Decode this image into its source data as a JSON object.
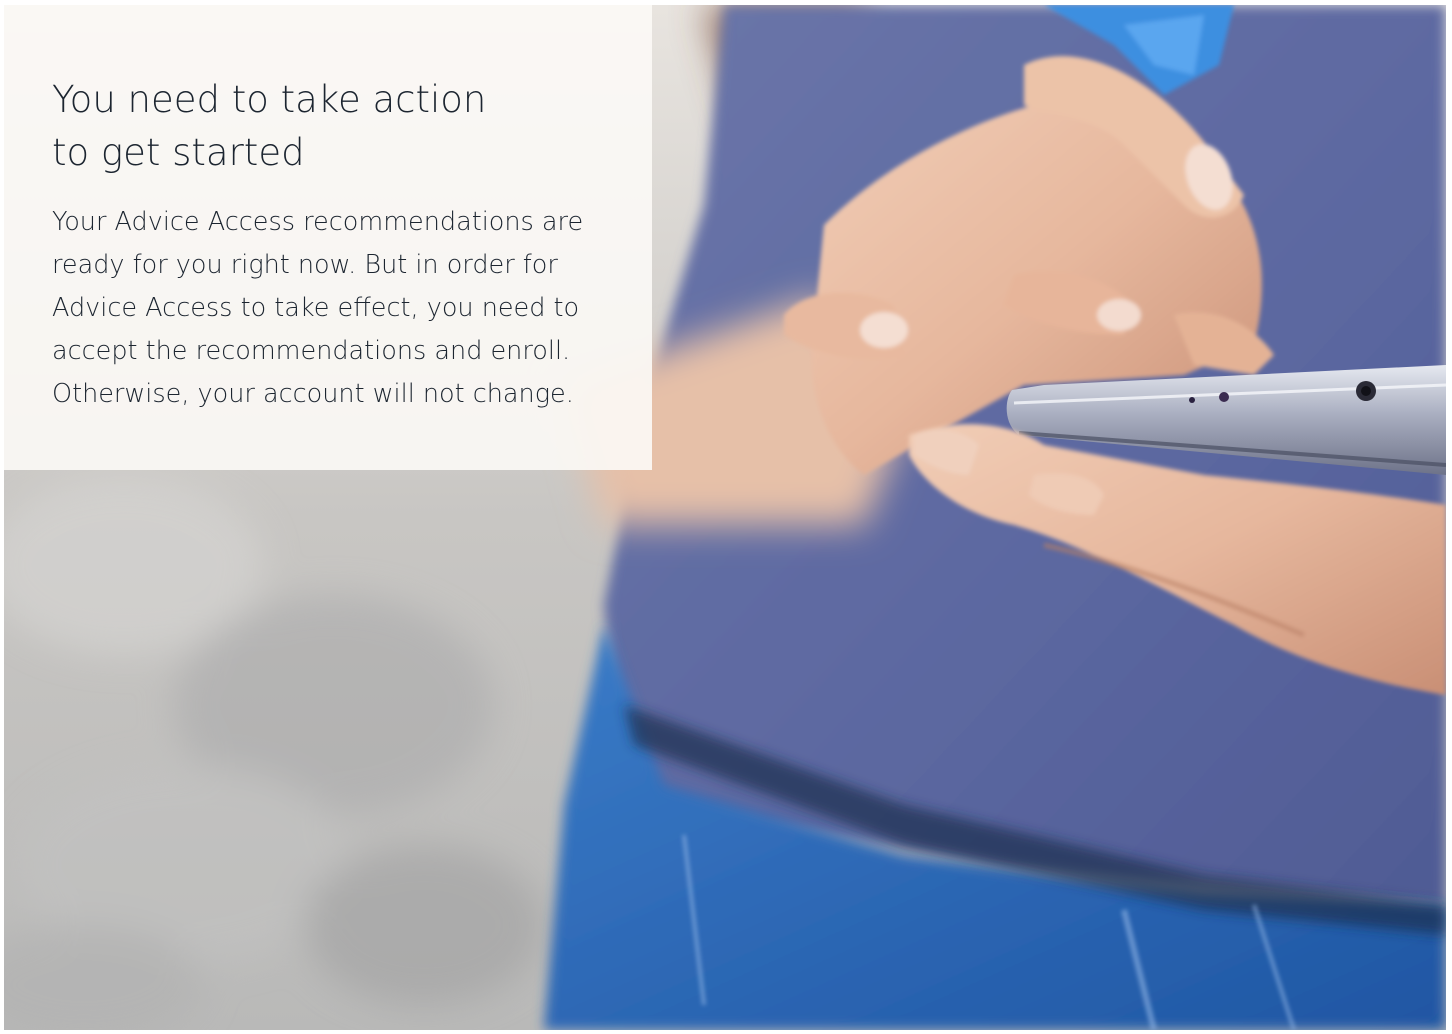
{
  "card": {
    "headline": "You need to take action to get started",
    "body": "Your Advice Access recommendations are ready for you right now. But in order for Advice Access to take effect, you need to accept the recommendations and enroll. Otherwise, your account will not change."
  },
  "colors": {
    "text": "#1c2530",
    "card_background": "#fcf9f6",
    "shirt": "#5c6aa4",
    "denim": "#2f6fc0"
  },
  "photo": {
    "subject": "person-typing-on-smartphone"
  }
}
